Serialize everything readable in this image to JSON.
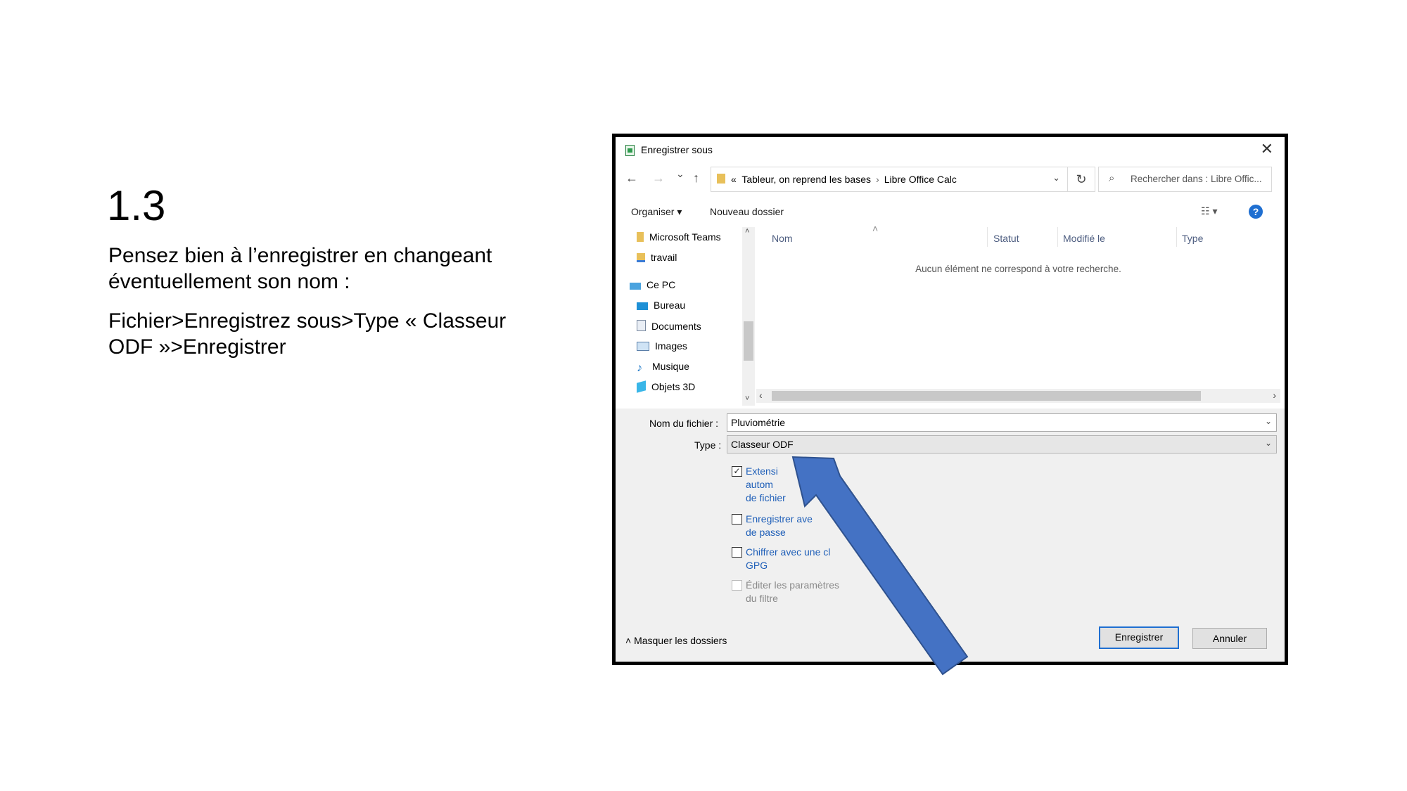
{
  "slide": {
    "title": "1.3",
    "text1": "Pensez bien à l’enregistrer en changeant éventuellement son nom :",
    "text2": "Fichier>Enregistrez sous>Type « Classeur ODF »>Enregistrer"
  },
  "dialog": {
    "title": "Enregistrer sous",
    "close": "✕",
    "nav": {
      "back": "←",
      "forward": "→",
      "recent": "⌄",
      "up": "↑"
    },
    "breadcrumb": {
      "prefix": "«",
      "part1": "Tableur, on reprend les bases",
      "sep": "›",
      "part2": "Libre Office Calc"
    },
    "address_dropdown": "⌄",
    "refresh": "↻",
    "search_placeholder": "Rechercher dans : Libre Offic...",
    "toolbar": {
      "organize": "Organiser ▾",
      "new_folder": "Nouveau dossier",
      "view": "☷ ▾",
      "help": "?"
    },
    "nav_pane": [
      {
        "label": "Microsoft Teams",
        "icon": "folder-icon"
      },
      {
        "label": "travail",
        "icon": "shared-folder-icon"
      },
      {
        "label": "Ce PC",
        "icon": "pc-icon"
      },
      {
        "label": "Bureau",
        "icon": "desktop-icon"
      },
      {
        "label": "Documents",
        "icon": "documents-icon"
      },
      {
        "label": "Images",
        "icon": "images-icon"
      },
      {
        "label": "Musique",
        "icon": "music-icon"
      },
      {
        "label": "Objets 3D",
        "icon": "3d-objects-icon"
      }
    ],
    "columns": {
      "name": "Nom",
      "status": "Statut",
      "modified": "Modifié le",
      "type": "Type"
    },
    "sort_indicator": "˄",
    "empty_message": "Aucun élément ne correspond à votre recherche.",
    "filename_label": "Nom du fichier :",
    "filename_value": "Pluviométrie",
    "type_label": "Type :",
    "type_value": "Classeur ODF",
    "options": [
      {
        "label": "Extension automatique du nom de fichier",
        "visible_lines": [
          "Extensi",
          "autom          nom",
          "de fichier"
        ],
        "checked": true,
        "enabled": true
      },
      {
        "label": "Enregistrer avec mot de passe",
        "visible_lines": [
          "Enregistrer ave",
          "de passe"
        ],
        "checked": false,
        "enabled": true
      },
      {
        "label": "Chiffrer avec une clé GPG",
        "visible_lines": [
          "Chiffrer avec une cl",
          "GPG"
        ],
        "checked": false,
        "enabled": true
      },
      {
        "label": "Éditer les paramètres du filtre",
        "visible_lines": [
          "Éditer les paramètres",
          "du filtre"
        ],
        "checked": false,
        "enabled": false
      }
    ],
    "hide_folders": "˄  Masquer les dossiers",
    "save_button": "Enregistrer",
    "cancel_button": "Annuler"
  },
  "colors": {
    "arrow_fill": "#4472c4",
    "arrow_stroke": "#2f528f",
    "accent": "#1f6fd1",
    "link": "#1f5fb8"
  }
}
